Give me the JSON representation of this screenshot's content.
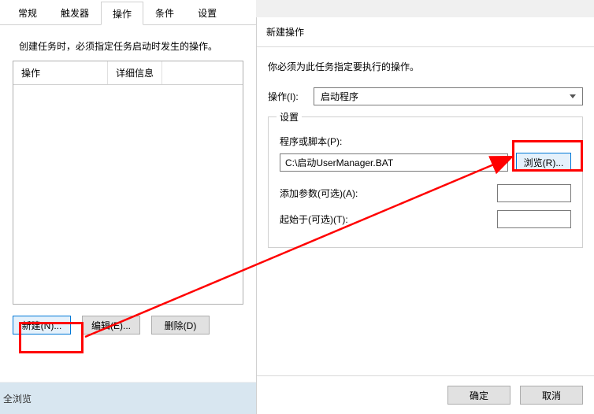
{
  "tabs": {
    "general": "常规",
    "triggers": "触发器",
    "actions": "操作",
    "conditions": "条件",
    "settings": "设置"
  },
  "leftPanel": {
    "instruction": "创建任务时，必须指定任务启动时发生的操作。",
    "col_action": "操作",
    "col_details": "详细信息",
    "btn_new": "新建(N)...",
    "btn_edit": "编辑(E)...",
    "btn_delete": "删除(D)"
  },
  "dialog": {
    "title": "新建操作",
    "desc": "你必须为此任务指定要执行的操作。",
    "action_label": "操作(I):",
    "action_value": "启动程序",
    "settings_legend": "设置",
    "program_label": "程序或脚本(P):",
    "program_value": "C:\\启动UserManager.BAT",
    "browse_btn": "浏览(R)...",
    "args_label": "添加参数(可选)(A):",
    "startin_label": "起始于(可选)(T):",
    "ok": "确定",
    "cancel": "取消"
  },
  "footer_hint": "全浏览"
}
